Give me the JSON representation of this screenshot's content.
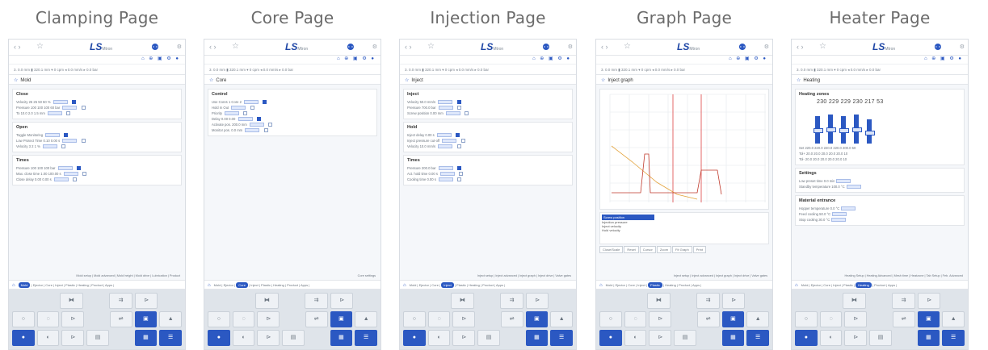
{
  "pages": [
    {
      "title": "Clamping Page",
      "header": "Mold",
      "tab_active": "Mold",
      "sections": [
        "Close",
        "Open",
        "Times"
      ],
      "lines": [
        "Velocity 25 25 50 50 %",
        "Pressure 100 100 100 60 bar",
        "To 10.0 2.0 1.5 mm",
        "Toggle Monitoring",
        "Low Protect Time 0.10 0.00 s",
        "Velocity 3 2 1 %",
        "Pressure 100 100 100 bar",
        "Max. close time 1.00 100.00 s",
        "Close delay 0.00 0.00 s"
      ],
      "subtabs": "Mold setup | Mold advanced | Mold height | Mold drive | Lubrication | Product"
    },
    {
      "title": "Core Page",
      "header": "Core",
      "tab_active": "Core",
      "sections": [
        "Control"
      ],
      "lines": [
        "Use Cores 1 Core 2",
        "Hold In Out",
        "Priority",
        "Delay 0.00 0.00",
        "Activate pos. 200.0 mm",
        "Monitor pos. 0.0 mm"
      ],
      "subtabs": "Core settings"
    },
    {
      "title": "Injection Page",
      "header": "Inject",
      "tab_active": "Inject",
      "sections": [
        "Inject",
        "Hold",
        "Times"
      ],
      "lines": [
        "Velocity 50.0 mm/s",
        "Pressure 700.0 bar",
        "Screw position 0.00 mm",
        "Inject delay 0.00 s",
        "Inject pressure cut-off",
        "Velocity 10.0 mm/s",
        "Pressure 200.0 bar",
        "Act. hold time 0.00 s",
        "Cooling time 0.00 s"
      ],
      "subtabs": "Inject setup | Inject advanced | Inject graph | Inject drive | Valve gates"
    },
    {
      "title": "Graph Page",
      "header": "Inject graph",
      "tab_active": "Plastic",
      "sections": [],
      "lines": [
        "Screw position",
        "Injection pressure",
        "Inject velocity",
        "Hold velocity"
      ],
      "buttons": [
        "Close/Scale",
        "Reset",
        "Cursor",
        "Zoom",
        "Fit Graph",
        "Print"
      ],
      "subtabs": "Inject setup | Inject advanced | Inject graph | Inject drive | Valve gates"
    },
    {
      "title": "Heater Page",
      "header": "Heating",
      "tab_active": "Heating",
      "sections": [
        "Heating zones",
        "Settings",
        "Material entrance"
      ],
      "temps": "230 229 229 230 217 53",
      "lines": [
        "Set 220.0 220.0 220.0 220.0 200.0 50",
        "Tol+ 20.0 20.0 20.0 20.0 20.0 10",
        "Tol- 20.0 20.0 20.0 20.0 20.0 10",
        "Low preset time 0.0 min",
        "Standby temperature 100.0 °C",
        "Hopper temperature 0.0 °C",
        "Feed cooling 50.0 °C",
        "Stop cooling 30.0 °C"
      ],
      "subtabs": "Heating Setup | Heating Advanced | Mesh time | Heatzone | Tab Setup | Feb. Advanced"
    }
  ],
  "common": {
    "logo": "LS",
    "logo_sub": "Mtron",
    "modules": [
      "Mold",
      "Ejector",
      "Core",
      "Inject",
      "Plastic",
      "Heating",
      "Product",
      "Apps"
    ],
    "status": "3. 0.0 mm  ▮ 320.1 mm  ▾ 0 cpm  ◂ 0.0 mm/s  ▸ 0.0 bar"
  }
}
